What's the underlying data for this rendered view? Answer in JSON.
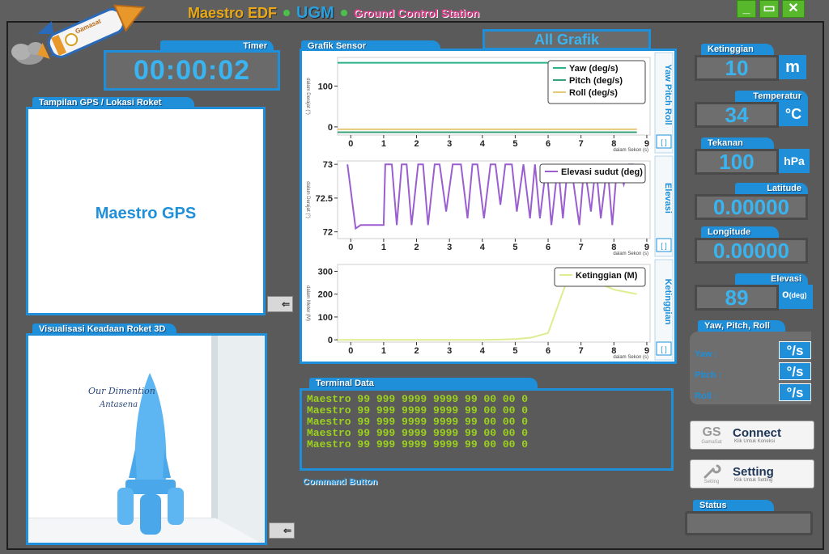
{
  "header": {
    "title_part1": "Maestro EDF",
    "title_part2": "UGM",
    "title_part3": "Ground Control Station",
    "logo_text": "Gamasat"
  },
  "window_controls": {
    "minimize": "_",
    "maximize": "▭",
    "close": "✕"
  },
  "timer": {
    "label": "Timer",
    "value": "00:00:02"
  },
  "gps": {
    "label": "Tampilan GPS / Lokasi Roket",
    "content": "Maestro GPS"
  },
  "viz3d": {
    "label": "Visualisasi Keadaan Roket 3D",
    "caption_line1": "Our Dimention",
    "caption_line2": "Antasena"
  },
  "graphs": {
    "label": "Grafik Sensor",
    "all_button": "All Grafik",
    "panels": [
      {
        "side_title": "Yaw Pitch Roll",
        "ylabel": "dalam Derajat (°)",
        "xlabel": "dalam Sekon (s)",
        "yticks": [
          "100",
          "0"
        ],
        "xticks": [
          "0",
          "1",
          "2",
          "3",
          "4",
          "5",
          "6",
          "7",
          "8",
          "9"
        ],
        "legend": [
          "Yaw (deg/s)",
          "Pitch (deg/s)",
          "Roll (deg/s)"
        ],
        "colors": [
          "#2ab08a",
          "#3aa07a",
          "#e8c878"
        ]
      },
      {
        "side_title": "Elevasi",
        "ylabel": "dalam Derajat (°)",
        "xlabel": "dalam Sekon (s)",
        "yticks": [
          "73",
          "72.5",
          "72"
        ],
        "xticks": [
          "0",
          "1",
          "2",
          "3",
          "4",
          "5",
          "6",
          "7",
          "8",
          "9"
        ],
        "legend": [
          "Elevasi sudut (deg)"
        ],
        "colors": [
          "#9a5ed0"
        ]
      },
      {
        "side_title": "Ketinggian",
        "ylabel": "dalam Meter (M)",
        "xlabel": "dalam Sekon (s)",
        "yticks": [
          "300",
          "200",
          "100",
          "0"
        ],
        "xticks": [
          "0",
          "1",
          "2",
          "3",
          "4",
          "5",
          "6",
          "7",
          "8",
          "9"
        ],
        "legend": [
          "Ketinggian (M)"
        ],
        "colors": [
          "#e0ec90"
        ]
      }
    ],
    "expand_glyph": "[ ]"
  },
  "chart_data": [
    {
      "type": "line",
      "xlabel": "dalam Sekon (s)",
      "ylabel": "dalam Derajat (°)",
      "xlim": [
        -0.4,
        9.1
      ],
      "ylim": [
        -20,
        170
      ],
      "series": [
        {
          "name": "Yaw (deg/s)",
          "x": [
            -0.4,
            8.7
          ],
          "y": [
            157,
            157
          ]
        },
        {
          "name": "Pitch (deg/s)",
          "x": [
            -0.4,
            8.7
          ],
          "y": [
            -13,
            -13
          ]
        },
        {
          "name": "Roll (deg/s)",
          "x": [
            -0.4,
            8.7
          ],
          "y": [
            -6,
            -6
          ]
        }
      ]
    },
    {
      "type": "line",
      "xlabel": "dalam Sekon (s)",
      "ylabel": "dalam Derajat (°)",
      "xlim": [
        -0.4,
        9.1
      ],
      "ylim": [
        71.9,
        73.05
      ],
      "series": [
        {
          "name": "Elevasi sudut (deg)",
          "x": [
            -0.1,
            0.15,
            0.3,
            0.6,
            1.0,
            1.05,
            1.25,
            1.4,
            1.55,
            1.7,
            1.85,
            2.05,
            2.2,
            2.35,
            2.55,
            2.7,
            2.9,
            3.1,
            3.35,
            3.55,
            3.7,
            3.85,
            4.05,
            4.25,
            4.4,
            4.55,
            4.7,
            4.9,
            5.05,
            5.25,
            5.45,
            5.6,
            5.75,
            5.95,
            6.1,
            6.3,
            6.45,
            6.6,
            6.75,
            6.95,
            7.1,
            7.3,
            7.45,
            7.6,
            7.8,
            7.95,
            8.1,
            8.3,
            8.45,
            8.6
          ],
          "y": [
            73,
            72.05,
            72.1,
            72.1,
            72.1,
            73,
            73,
            72.1,
            73,
            73,
            72.1,
            73,
            73,
            72.1,
            73,
            73,
            72.3,
            73,
            73,
            72.2,
            73,
            73,
            72.2,
            73,
            73,
            72.4,
            73,
            73,
            72.3,
            73,
            72.2,
            73,
            72.2,
            73,
            72.1,
            73,
            72.2,
            73,
            72.8,
            72.1,
            73,
            72.3,
            73,
            72.2,
            73,
            72.1,
            73,
            72.7,
            73,
            73
          ]
        }
      ]
    },
    {
      "type": "line",
      "xlabel": "dalam Sekon (s)",
      "ylabel": "dalam Meter (M)",
      "xlim": [
        -0.4,
        9.1
      ],
      "ylim": [
        -10,
        330
      ],
      "series": [
        {
          "name": "Ketinggian (M)",
          "x": [
            -0.4,
            1,
            2,
            3,
            4,
            4.5,
            5,
            5.5,
            6,
            6.5,
            6.7,
            7,
            7.5,
            8,
            8.7
          ],
          "y": [
            0,
            0,
            0,
            0,
            0,
            1,
            3,
            10,
            30,
            230,
            300,
            290,
            250,
            220,
            200
          ]
        }
      ]
    }
  ],
  "terminal": {
    "label": "Terminal Data",
    "lines": [
      "Maestro 99 999 9999 9999 99 00 00 0",
      "Maestro 99 999 9999 9999 99 00 00 0",
      "Maestro 99 999 9999 9999 99 00 00 0",
      "Maestro 99 999 9999 9999 99 00 00 0",
      "Maestro 99 999 9999 9999 99 00 00 0"
    ]
  },
  "command": {
    "label": "Command Button"
  },
  "telemetry": {
    "ketinggian": {
      "label": "Ketinggian",
      "value": "10",
      "unit": "m"
    },
    "temperatur": {
      "label": "Temperatur",
      "value": "34",
      "unit": "°C"
    },
    "tekanan": {
      "label": "Tekanan",
      "value": "100",
      "unit": "hPa"
    },
    "latitude": {
      "label": "Latitude",
      "value": "0.00000"
    },
    "longitude": {
      "label": "Longitude",
      "value": "0.00000"
    },
    "elevasi": {
      "label": "Elevasi",
      "value": "89",
      "unit": "o",
      "unit_sub": "(deg)"
    }
  },
  "ypr": {
    "label": "Yaw, Pitch, Roll",
    "rows": [
      {
        "label": "Yaw  :",
        "unit": "°/s"
      },
      {
        "label": "Pitch :",
        "unit": "°/s"
      },
      {
        "label": "Roll  :",
        "unit": "°/s"
      }
    ]
  },
  "connect_button": {
    "icon_text": "GS",
    "icon_sub": "GamaSat",
    "label": "Connect",
    "sub": "Klik Untuk Koneksi"
  },
  "setting_button": {
    "icon_sub": "Setting",
    "label": "Setting",
    "sub": "Klik Untuk Setting"
  },
  "status": {
    "label": "Status",
    "value": ""
  },
  "side_buttons": {
    "arrow": "⇐"
  }
}
